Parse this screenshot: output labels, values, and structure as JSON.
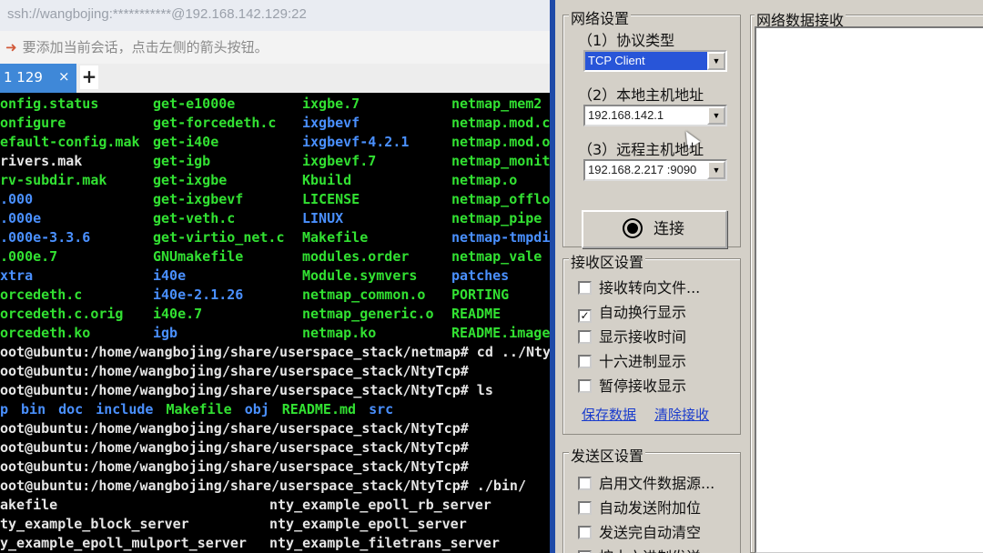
{
  "terminal": {
    "title": "ssh://wangbojing:***********@192.168.142.129:22",
    "hint": "要添加当前会话，点击左侧的箭头按钮。",
    "tab_label": "1 129",
    "tab_close": "×",
    "new_tab": "+",
    "grid": [
      [
        [
          "onfig.status",
          "g"
        ],
        [
          "get-e1000e",
          "g"
        ],
        [
          "ixgbe.7",
          "g"
        ],
        [
          "netmap_mem2",
          "g"
        ]
      ],
      [
        [
          "onfigure",
          "g"
        ],
        [
          "get-forcedeth.c",
          "g"
        ],
        [
          "ixgbevf",
          "b"
        ],
        [
          "netmap.mod.c",
          "g"
        ]
      ],
      [
        [
          "efault-config.mak",
          "g"
        ],
        [
          "get-i40e",
          "g"
        ],
        [
          "ixgbevf-4.2.1",
          "b"
        ],
        [
          "netmap.mod.o",
          "g"
        ]
      ],
      [
        [
          "rivers.mak",
          "w"
        ],
        [
          "get-igb",
          "g"
        ],
        [
          "ixgbevf.7",
          "g"
        ],
        [
          "netmap_monitor",
          "g"
        ]
      ],
      [
        [
          "rv-subdir.mak",
          "g"
        ],
        [
          "get-ixgbe",
          "g"
        ],
        [
          "Kbuild",
          "g"
        ],
        [
          "netmap.o",
          "g"
        ]
      ],
      [
        [
          ".000",
          "b"
        ],
        [
          "get-ixgbevf",
          "g"
        ],
        [
          "LICENSE",
          "g"
        ],
        [
          "netmap_offload",
          "g"
        ]
      ],
      [
        [
          ".000e",
          "b"
        ],
        [
          "get-veth.c",
          "g"
        ],
        [
          "LINUX",
          "b"
        ],
        [
          "netmap_pipe",
          "g"
        ]
      ],
      [
        [
          ".000e-3.3.6",
          "b"
        ],
        [
          "get-virtio_net.c",
          "g"
        ],
        [
          "Makefile",
          "g"
        ],
        [
          "netmap-tmpdir",
          "b"
        ]
      ],
      [
        [
          ".000e.7",
          "g"
        ],
        [
          "GNUmakefile",
          "g"
        ],
        [
          "modules.order",
          "g"
        ],
        [
          "netmap_vale",
          "g"
        ]
      ],
      [
        [
          "xtra",
          "b"
        ],
        [
          "i40e",
          "b"
        ],
        [
          "Module.symvers",
          "g"
        ],
        [
          "patches",
          "b"
        ]
      ],
      [
        [
          "orcedeth.c",
          "g"
        ],
        [
          "i40e-2.1.26",
          "b"
        ],
        [
          "netmap_common.o",
          "g"
        ],
        [
          "PORTING",
          "g"
        ]
      ],
      [
        [
          "orcedeth.c.orig",
          "g"
        ],
        [
          "i40e.7",
          "g"
        ],
        [
          "netmap_generic.o",
          "g"
        ],
        [
          "README",
          "g"
        ]
      ],
      [
        [
          "orcedeth.ko",
          "g"
        ],
        [
          "igb",
          "b"
        ],
        [
          "netmap.ko",
          "g"
        ],
        [
          "README.images",
          "g"
        ]
      ]
    ],
    "lines": [
      "oot@ubuntu:/home/wangbojing/share/userspace_stack/netmap# cd ../NtyTcp/",
      "oot@ubuntu:/home/wangbojing/share/userspace_stack/NtyTcp#",
      "oot@ubuntu:/home/wangbojing/share/userspace_stack/NtyTcp# ls"
    ],
    "ls_output": [
      [
        "p",
        "b"
      ],
      [
        "bin",
        "b"
      ],
      [
        "doc",
        "b"
      ],
      [
        "include",
        "b"
      ],
      [
        "Makefile",
        "g"
      ],
      [
        "obj",
        "b"
      ],
      [
        "README.md",
        "g"
      ],
      [
        "src",
        "b"
      ]
    ],
    "lines2": [
      "oot@ubuntu:/home/wangbojing/share/userspace_stack/NtyTcp#",
      "oot@ubuntu:/home/wangbojing/share/userspace_stack/NtyTcp#",
      "oot@ubuntu:/home/wangbojing/share/userspace_stack/NtyTcp#",
      "oot@ubuntu:/home/wangbojing/share/userspace_stack/NtyTcp# ./bin/"
    ],
    "bin_listing": [
      [
        "akefile",
        "nty_example_epoll_rb_server"
      ],
      [
        "ty_example_block_server",
        "nty_example_epoll_server"
      ],
      [
        "y_example_epoll_mulport_server",
        "nty_example_filetrans_server"
      ]
    ]
  },
  "assistant": {
    "net_settings_title": "网络设置",
    "protocol_label": "（1）协议类型",
    "protocol_value": "TCP Client",
    "local_label": "（2）本地主机地址",
    "local_value": "192.168.142.1",
    "remote_label": "（3）远程主机地址",
    "remote_value": "192.168.2.217 :9090",
    "connect_label": "连接",
    "recv_settings_title": "接收区设置",
    "recv_options": [
      {
        "label": "接收转向文件...",
        "checked": false
      },
      {
        "label": "自动换行显示",
        "checked": true
      },
      {
        "label": "显示接收时间",
        "checked": false
      },
      {
        "label": "十六进制显示",
        "checked": false
      },
      {
        "label": "暂停接收显示",
        "checked": false
      }
    ],
    "save_data": "保存数据",
    "clear_recv": "清除接收",
    "send_settings_title": "发送区设置",
    "send_options": [
      {
        "label": "启用文件数据源...",
        "checked": false
      },
      {
        "label": "自动发送附加位",
        "checked": false
      },
      {
        "label": "发送完自动清空",
        "checked": false
      },
      {
        "label": "按十六进制发送",
        "checked": false
      }
    ],
    "recv_area_title": "网络数据接收",
    "check_mark": "✓"
  }
}
